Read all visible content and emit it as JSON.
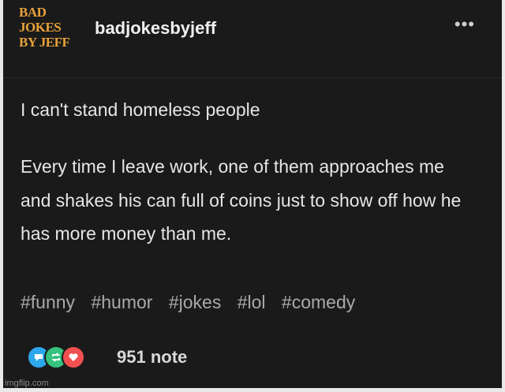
{
  "header": {
    "logo_lines": [
      "BAD",
      "JOKES",
      "BY JEFF"
    ],
    "username": "badjokesbyjeff",
    "more_label": "•••"
  },
  "post": {
    "title": "I can't stand homeless people",
    "body": "Every time I leave work, one of them approaches me and shakes his can full of coins just to show off how he has more money than me.",
    "tags": [
      "#funny",
      "#humor",
      "#jokes",
      "#lol",
      "#comedy"
    ]
  },
  "footer": {
    "note_count": "951 note"
  },
  "watermark": "imgflip.com",
  "colors": {
    "background": "#1a1a1a",
    "logo": "#e8a23a",
    "comment": "#2ea8ec",
    "reblog": "#35c37e",
    "like": "#f0504f"
  }
}
